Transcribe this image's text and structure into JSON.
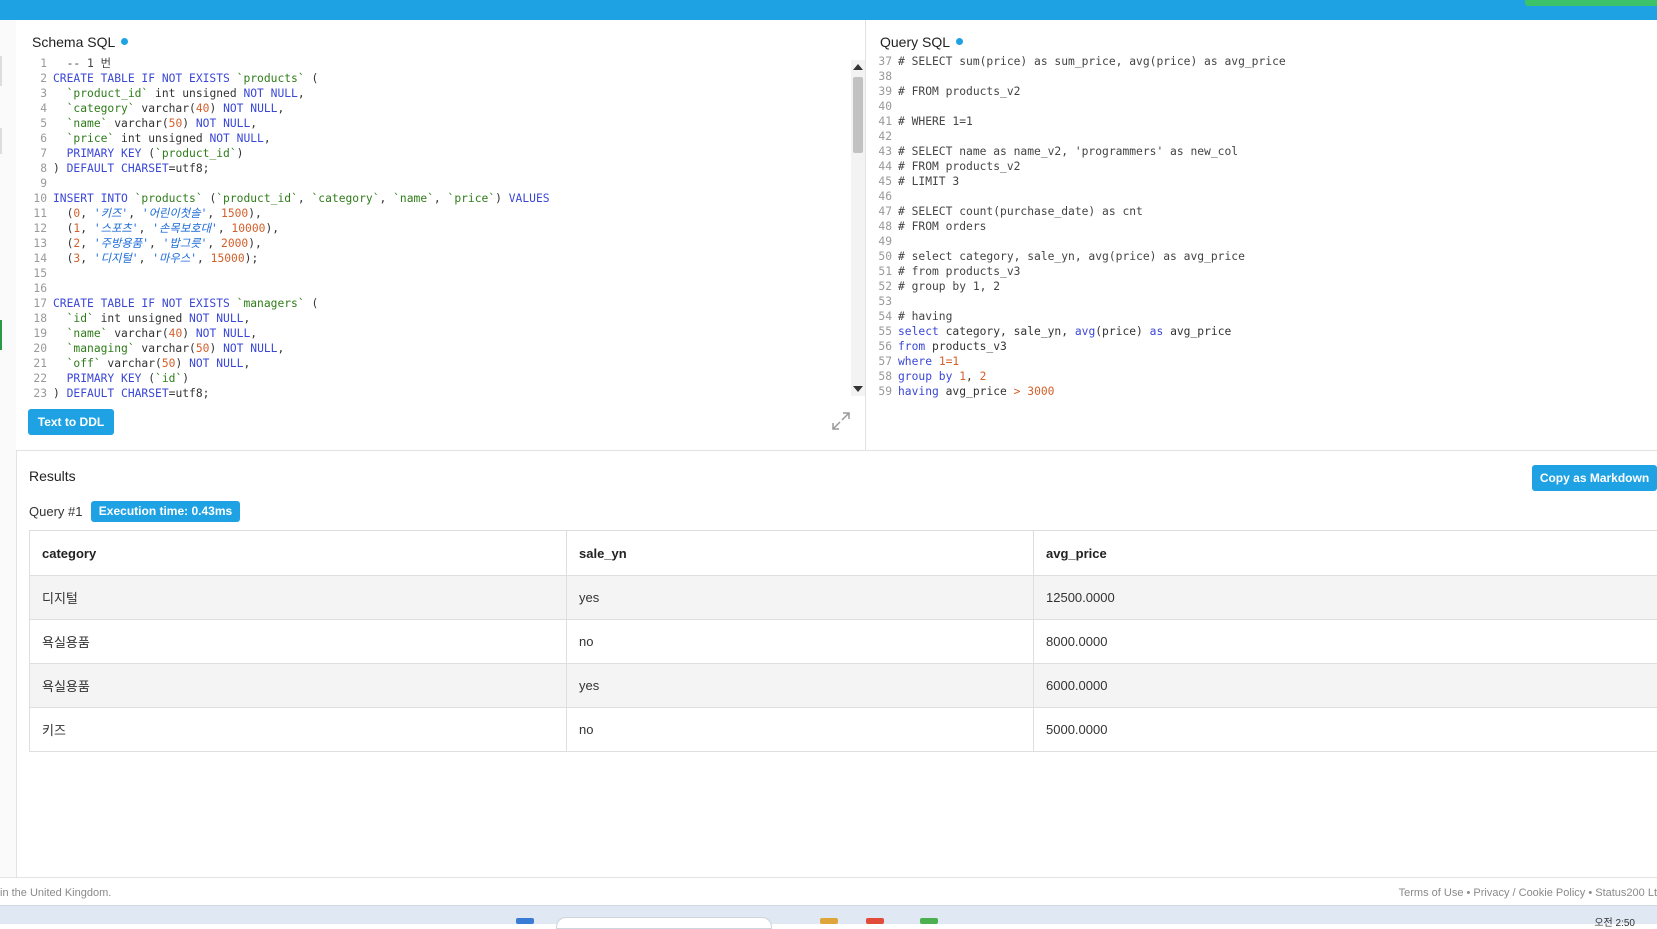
{
  "schema_panel": {
    "title": "Schema SQL",
    "lines": [
      {
        "n": "1",
        "segs": [
          {
            "t": "  -- 1 번 ",
            "c": "cm"
          }
        ]
      },
      {
        "n": "2",
        "segs": [
          {
            "t": "CREATE TABLE IF NOT EXISTS ",
            "c": "kw"
          },
          {
            "t": "`products`",
            "c": "bt"
          },
          {
            "t": " (",
            "c": ""
          }
        ]
      },
      {
        "n": "3",
        "segs": [
          {
            "t": "  ",
            "c": ""
          },
          {
            "t": "`product_id`",
            "c": "bt"
          },
          {
            "t": " int unsigned ",
            "c": ""
          },
          {
            "t": "NOT NULL",
            "c": "kw"
          },
          {
            "t": ",",
            "c": ""
          }
        ]
      },
      {
        "n": "4",
        "segs": [
          {
            "t": "  ",
            "c": ""
          },
          {
            "t": "`category`",
            "c": "bt"
          },
          {
            "t": " varchar(",
            "c": ""
          },
          {
            "t": "40",
            "c": "num"
          },
          {
            "t": ") ",
            "c": ""
          },
          {
            "t": "NOT NULL",
            "c": "kw"
          },
          {
            "t": ",",
            "c": ""
          }
        ]
      },
      {
        "n": "5",
        "segs": [
          {
            "t": "  ",
            "c": ""
          },
          {
            "t": "`name`",
            "c": "bt"
          },
          {
            "t": " varchar(",
            "c": ""
          },
          {
            "t": "50",
            "c": "num"
          },
          {
            "t": ") ",
            "c": ""
          },
          {
            "t": "NOT NULL",
            "c": "kw"
          },
          {
            "t": ",",
            "c": ""
          }
        ]
      },
      {
        "n": "6",
        "segs": [
          {
            "t": "  ",
            "c": ""
          },
          {
            "t": "`price`",
            "c": "bt"
          },
          {
            "t": " int unsigned ",
            "c": ""
          },
          {
            "t": "NOT NULL",
            "c": "kw"
          },
          {
            "t": ",",
            "c": ""
          }
        ]
      },
      {
        "n": "7",
        "segs": [
          {
            "t": "  ",
            "c": ""
          },
          {
            "t": "PRIMARY KEY",
            "c": "kw"
          },
          {
            "t": " (",
            "c": ""
          },
          {
            "t": "`product_id`",
            "c": "bt"
          },
          {
            "t": ")",
            "c": ""
          }
        ]
      },
      {
        "n": "8",
        "segs": [
          {
            "t": ") ",
            "c": ""
          },
          {
            "t": "DEFAULT CHARSET",
            "c": "kw"
          },
          {
            "t": "=utf8;",
            "c": ""
          }
        ]
      },
      {
        "n": "9",
        "segs": []
      },
      {
        "n": "10",
        "segs": [
          {
            "t": "INSERT INTO ",
            "c": "kw"
          },
          {
            "t": "`products`",
            "c": "bt"
          },
          {
            "t": " (",
            "c": ""
          },
          {
            "t": "`product_id`",
            "c": "bt"
          },
          {
            "t": ", ",
            "c": ""
          },
          {
            "t": "`category`",
            "c": "bt"
          },
          {
            "t": ", ",
            "c": ""
          },
          {
            "t": "`name`",
            "c": "bt"
          },
          {
            "t": ", ",
            "c": ""
          },
          {
            "t": "`price`",
            "c": "bt"
          },
          {
            "t": ") ",
            "c": ""
          },
          {
            "t": "VALUES",
            "c": "kw"
          }
        ]
      },
      {
        "n": "11",
        "segs": [
          {
            "t": "  (",
            "c": ""
          },
          {
            "t": "0",
            "c": "num"
          },
          {
            "t": ", ",
            "c": ""
          },
          {
            "t": "'키즈'",
            "c": "str"
          },
          {
            "t": ", ",
            "c": ""
          },
          {
            "t": "'어린이첫솔'",
            "c": "str"
          },
          {
            "t": ", ",
            "c": ""
          },
          {
            "t": "1500",
            "c": "num"
          },
          {
            "t": "),",
            "c": ""
          }
        ]
      },
      {
        "n": "12",
        "segs": [
          {
            "t": "  (",
            "c": ""
          },
          {
            "t": "1",
            "c": "num"
          },
          {
            "t": ", ",
            "c": ""
          },
          {
            "t": "'스포츠'",
            "c": "str"
          },
          {
            "t": ", ",
            "c": ""
          },
          {
            "t": "'손목보호대'",
            "c": "str"
          },
          {
            "t": ", ",
            "c": ""
          },
          {
            "t": "10000",
            "c": "num"
          },
          {
            "t": "),",
            "c": ""
          }
        ]
      },
      {
        "n": "13",
        "segs": [
          {
            "t": "  (",
            "c": ""
          },
          {
            "t": "2",
            "c": "num"
          },
          {
            "t": ", ",
            "c": ""
          },
          {
            "t": "'주방용품'",
            "c": "str"
          },
          {
            "t": ", ",
            "c": ""
          },
          {
            "t": "'밥그릇'",
            "c": "str"
          },
          {
            "t": ", ",
            "c": ""
          },
          {
            "t": "2000",
            "c": "num"
          },
          {
            "t": "),",
            "c": ""
          }
        ]
      },
      {
        "n": "14",
        "segs": [
          {
            "t": "  (",
            "c": ""
          },
          {
            "t": "3",
            "c": "num"
          },
          {
            "t": ", ",
            "c": ""
          },
          {
            "t": "'디지털'",
            "c": "str"
          },
          {
            "t": ", ",
            "c": ""
          },
          {
            "t": "'마우스'",
            "c": "str"
          },
          {
            "t": ", ",
            "c": ""
          },
          {
            "t": "15000",
            "c": "num"
          },
          {
            "t": ");",
            "c": ""
          }
        ]
      },
      {
        "n": "15",
        "segs": []
      },
      {
        "n": "16",
        "segs": []
      },
      {
        "n": "17",
        "segs": [
          {
            "t": "CREATE TABLE IF NOT EXISTS ",
            "c": "kw"
          },
          {
            "t": "`managers`",
            "c": "bt"
          },
          {
            "t": " (",
            "c": ""
          }
        ]
      },
      {
        "n": "18",
        "segs": [
          {
            "t": "  ",
            "c": ""
          },
          {
            "t": "`id`",
            "c": "bt"
          },
          {
            "t": " int unsigned ",
            "c": ""
          },
          {
            "t": "NOT NULL",
            "c": "kw"
          },
          {
            "t": ",",
            "c": ""
          }
        ]
      },
      {
        "n": "19",
        "segs": [
          {
            "t": "  ",
            "c": ""
          },
          {
            "t": "`name`",
            "c": "bt"
          },
          {
            "t": " varchar(",
            "c": ""
          },
          {
            "t": "40",
            "c": "num"
          },
          {
            "t": ") ",
            "c": ""
          },
          {
            "t": "NOT NULL",
            "c": "kw"
          },
          {
            "t": ",",
            "c": ""
          }
        ]
      },
      {
        "n": "20",
        "segs": [
          {
            "t": "  ",
            "c": ""
          },
          {
            "t": "`managing`",
            "c": "bt"
          },
          {
            "t": " varchar(",
            "c": ""
          },
          {
            "t": "50",
            "c": "num"
          },
          {
            "t": ") ",
            "c": ""
          },
          {
            "t": "NOT NULL",
            "c": "kw"
          },
          {
            "t": ",",
            "c": ""
          }
        ]
      },
      {
        "n": "21",
        "segs": [
          {
            "t": "  ",
            "c": ""
          },
          {
            "t": "`off`",
            "c": "bt"
          },
          {
            "t": " varchar(",
            "c": ""
          },
          {
            "t": "50",
            "c": "num"
          },
          {
            "t": ") ",
            "c": ""
          },
          {
            "t": "NOT NULL",
            "c": "kw"
          },
          {
            "t": ",",
            "c": ""
          }
        ]
      },
      {
        "n": "22",
        "segs": [
          {
            "t": "  ",
            "c": ""
          },
          {
            "t": "PRIMARY KEY",
            "c": "kw"
          },
          {
            "t": " (",
            "c": ""
          },
          {
            "t": "`id`",
            "c": "bt"
          },
          {
            "t": ")",
            "c": ""
          }
        ]
      },
      {
        "n": "23",
        "segs": [
          {
            "t": ") ",
            "c": ""
          },
          {
            "t": "DEFAULT CHARSET",
            "c": "kw"
          },
          {
            "t": "=utf8;",
            "c": ""
          }
        ]
      }
    ],
    "button_label": "Text to DDL"
  },
  "query_panel": {
    "title": "Query SQL",
    "lines": [
      {
        "n": "37",
        "segs": [
          {
            "t": "# SELECT sum(price) as sum_price, avg(price) as avg_price",
            "c": "cm"
          }
        ]
      },
      {
        "n": "38",
        "segs": []
      },
      {
        "n": "39",
        "segs": [
          {
            "t": "# FROM products_v2",
            "c": "cm"
          }
        ]
      },
      {
        "n": "40",
        "segs": []
      },
      {
        "n": "41",
        "segs": [
          {
            "t": "# WHERE 1=1",
            "c": "cm"
          }
        ]
      },
      {
        "n": "42",
        "segs": []
      },
      {
        "n": "43",
        "segs": [
          {
            "t": "# SELECT name as name_v2, 'programmers' as new_col",
            "c": "cm"
          }
        ]
      },
      {
        "n": "44",
        "segs": [
          {
            "t": "# FROM products_v2",
            "c": "cm"
          }
        ]
      },
      {
        "n": "45",
        "segs": [
          {
            "t": "# LIMIT 3",
            "c": "cm"
          }
        ]
      },
      {
        "n": "46",
        "segs": []
      },
      {
        "n": "47",
        "segs": [
          {
            "t": "# SELECT count(purchase_date) as cnt",
            "c": "cm"
          }
        ]
      },
      {
        "n": "48",
        "segs": [
          {
            "t": "# FROM orders",
            "c": "cm"
          }
        ]
      },
      {
        "n": "49",
        "segs": []
      },
      {
        "n": "50",
        "segs": [
          {
            "t": "# select category, sale_yn, avg(price) as avg_price",
            "c": "cm"
          }
        ]
      },
      {
        "n": "51",
        "segs": [
          {
            "t": "# from products_v3",
            "c": "cm"
          }
        ]
      },
      {
        "n": "52",
        "segs": [
          {
            "t": "# group by 1, 2",
            "c": "cm"
          }
        ]
      },
      {
        "n": "53",
        "segs": []
      },
      {
        "n": "54",
        "segs": [
          {
            "t": "# having",
            "c": "cm"
          }
        ]
      },
      {
        "n": "55",
        "segs": [
          {
            "t": "select",
            "c": "kw"
          },
          {
            "t": " category, sale_yn, ",
            "c": ""
          },
          {
            "t": "avg",
            "c": "kw"
          },
          {
            "t": "(price) ",
            "c": ""
          },
          {
            "t": "as",
            "c": "kw"
          },
          {
            "t": " avg_price",
            "c": ""
          }
        ]
      },
      {
        "n": "56",
        "segs": [
          {
            "t": "from",
            "c": "kw"
          },
          {
            "t": " products_v3",
            "c": ""
          }
        ]
      },
      {
        "n": "57",
        "segs": [
          {
            "t": "where",
            "c": "kw"
          },
          {
            "t": " ",
            "c": ""
          },
          {
            "t": "1=1",
            "c": "num"
          }
        ]
      },
      {
        "n": "58",
        "segs": [
          {
            "t": "group by",
            "c": "kw"
          },
          {
            "t": " ",
            "c": ""
          },
          {
            "t": "1",
            "c": "num"
          },
          {
            "t": ", ",
            "c": ""
          },
          {
            "t": "2",
            "c": "num"
          }
        ]
      },
      {
        "n": "59",
        "segs": [
          {
            "t": "having",
            "c": "kw"
          },
          {
            "t": " avg_price ",
            "c": ""
          },
          {
            "t": ">",
            "c": "num"
          },
          {
            "t": " ",
            "c": ""
          },
          {
            "t": "3000",
            "c": "num"
          }
        ]
      }
    ]
  },
  "results": {
    "title": "Results",
    "copy_button": "Copy as Markdown",
    "query_label": "Query #1",
    "execution_time": "Execution time: 0.43ms",
    "columns": [
      "category",
      "sale_yn",
      "avg_price"
    ],
    "rows": [
      [
        "디지털",
        "yes",
        "12500.0000"
      ],
      [
        "욕실용품",
        "no",
        "8000.0000"
      ],
      [
        "욕실용품",
        "yes",
        "6000.0000"
      ],
      [
        "키즈",
        "no",
        "5000.0000"
      ]
    ]
  },
  "footer": {
    "left_text": "in the United Kingdom.",
    "right_text": "Terms of Use • Privacy / Cookie Policy • Status200 Lt"
  },
  "taskbar": {
    "clock": "오전 2:50"
  },
  "colors": {
    "accent": "#1fa2e3",
    "run_button": "#3cc36a",
    "keyword": "#3a47d6",
    "number": "#d3602b",
    "string": "#1a6ad8",
    "identifier": "#2f7d1a"
  }
}
